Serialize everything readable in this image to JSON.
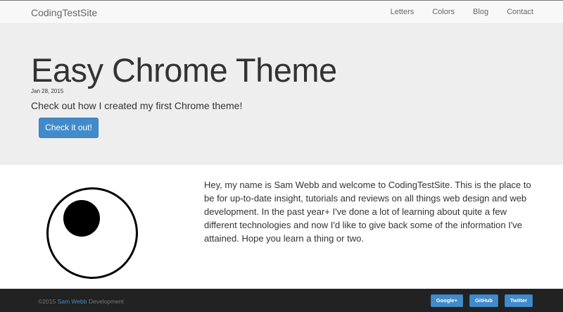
{
  "navbar": {
    "brand": "CodingTestSite",
    "links": [
      "Letters",
      "Colors",
      "Blog",
      "Contact"
    ]
  },
  "hero": {
    "title": "Easy Chrome Theme",
    "date": "Jan 28, 2015",
    "subtitle": "Check out how I created my first Chrome theme!",
    "button_label": "Check it out!"
  },
  "intro": {
    "text": "Hey, my name is Sam Webb and welcome to CodingTestSite. This is the place to be for up-to-date insight, tutorials and reviews on all things web design and web development. In the past year+ I've done a lot of learning about quite a few different technologies and now I'd like to give back some of the information I've attained. Hope you learn a thing or two."
  },
  "footer": {
    "copyright_prefix": "©2015",
    "author_link": "Sam Webb",
    "copyright_suffix": "Development",
    "social": [
      "Google+",
      "GitHub",
      "Twitter"
    ]
  },
  "colors": {
    "accent": "#428bca",
    "jumbotron_bg": "#eeeeee",
    "footer_bg": "#222222"
  },
  "icons": {
    "logo": "eye-logo-icon"
  }
}
